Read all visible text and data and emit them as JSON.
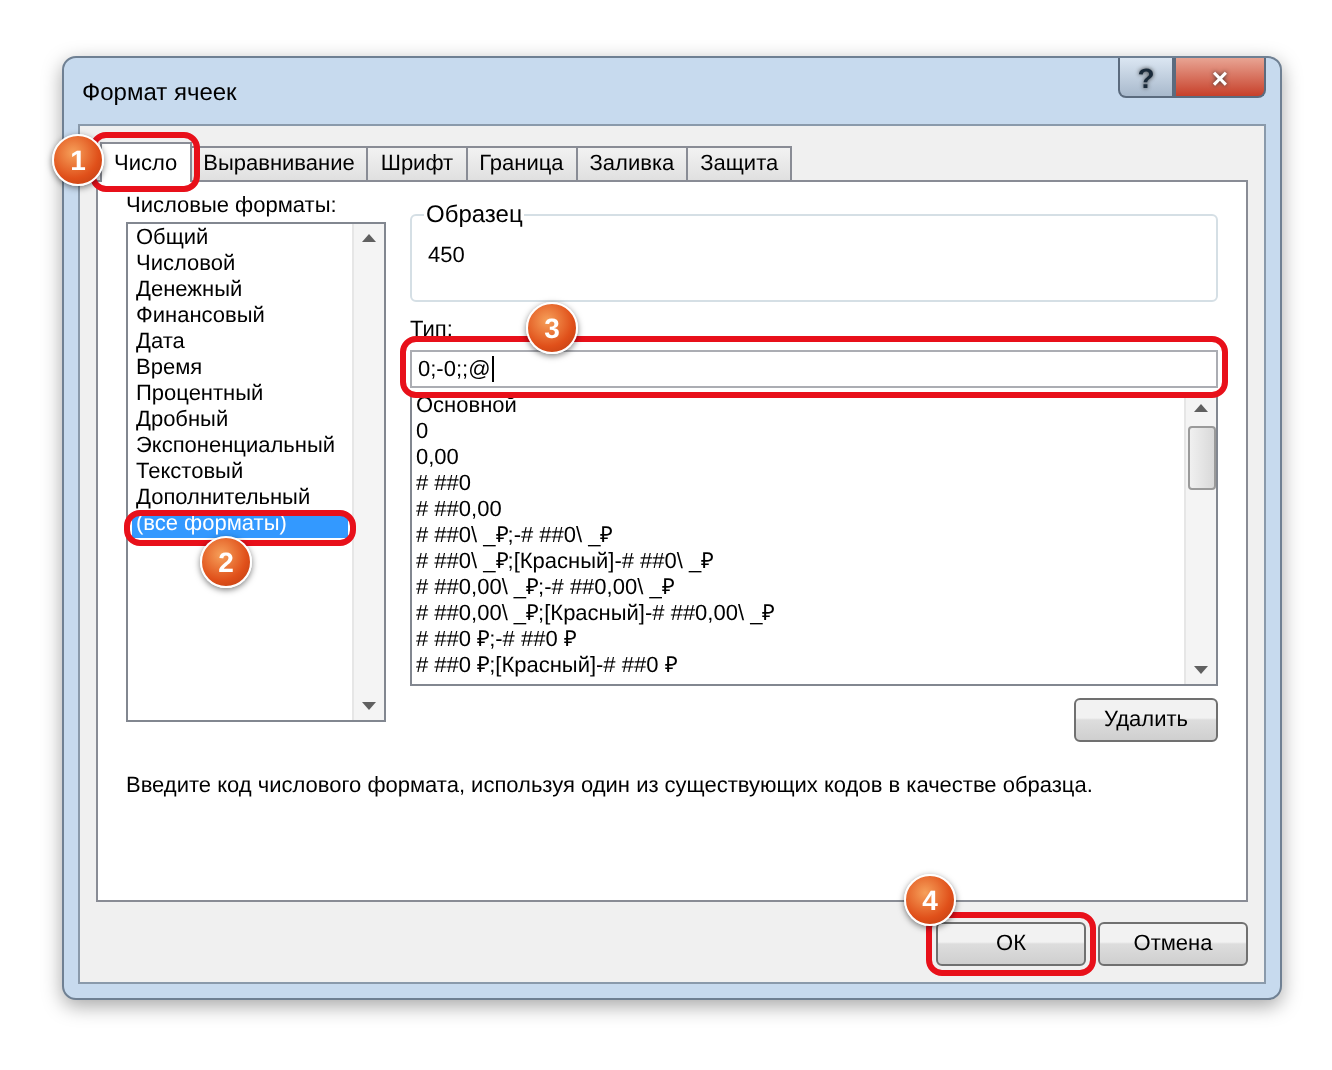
{
  "window": {
    "title": "Формат ячеек",
    "help": "?",
    "close": "×"
  },
  "tabs": [
    {
      "label": "Число",
      "selected": true,
      "callout": "1"
    },
    {
      "label": "Выравнивание",
      "selected": false
    },
    {
      "label": "Шрифт",
      "selected": false
    },
    {
      "label": "Граница",
      "selected": false
    },
    {
      "label": "Заливка",
      "selected": false
    },
    {
      "label": "Защита",
      "selected": false
    }
  ],
  "categories": {
    "label": "Числовые форматы:",
    "items": [
      {
        "label": "Общий",
        "selected": false
      },
      {
        "label": "Числовой",
        "selected": false
      },
      {
        "label": "Денежный",
        "selected": false
      },
      {
        "label": "Финансовый",
        "selected": false
      },
      {
        "label": "Дата",
        "selected": false
      },
      {
        "label": "Время",
        "selected": false
      },
      {
        "label": "Процентный",
        "selected": false
      },
      {
        "label": "Дробный",
        "selected": false
      },
      {
        "label": "Экспоненциальный",
        "selected": false
      },
      {
        "label": "Текстовый",
        "selected": false
      },
      {
        "label": "Дополнительный",
        "selected": false
      },
      {
        "label": "(все форматы)",
        "selected": true,
        "callout": "2"
      }
    ]
  },
  "sample": {
    "label": "Образец",
    "value": "450"
  },
  "type": {
    "label": "Тип:",
    "value": "0;-0;;@",
    "callout": "3"
  },
  "formats": [
    "Основной",
    "0",
    "0,00",
    "# ##0",
    "# ##0,00",
    "# ##0\\ _₽;-# ##0\\ _₽",
    "# ##0\\ _₽;[Красный]-# ##0\\ _₽",
    "# ##0,00\\ _₽;-# ##0,00\\ _₽",
    "# ##0,00\\ _₽;[Красный]-# ##0,00\\ _₽",
    "# ##0 ₽;-# ##0 ₽",
    "# ##0 ₽;[Красный]-# ##0 ₽"
  ],
  "delete_button": "Удалить",
  "hint": "Введите код числового формата, используя один из существующих кодов в качестве образца.",
  "buttons": [
    {
      "label": "ОК",
      "callout": "4"
    },
    {
      "label": "Отмена"
    }
  ]
}
